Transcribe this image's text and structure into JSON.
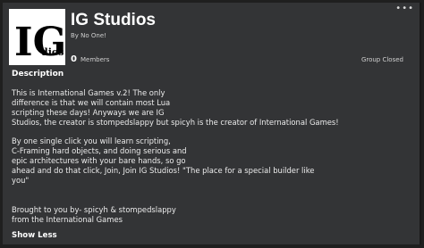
{
  "header": {
    "menu_glyph": "•••",
    "logo_text_main": "IG",
    "logo_text_small": "dios",
    "title": "IG Studios",
    "byline": "By No One!"
  },
  "stats": {
    "member_count": "0",
    "member_label": "Members",
    "group_status": "Group Closed"
  },
  "description": {
    "heading": "Description",
    "lines": [
      "This is International Games v.2! The only",
      "difference is that we will contain most Lua",
      "scripting these days! Anyways we are IG",
      "Studios, the creator is stompedslappy but spicyh is the creator of International Games!",
      "",
      "By one single click you will learn scripting,",
      "C-Framing hard objects, and doing serious and",
      "epic architectures with your bare hands, so go",
      "ahead and do that click, Join, Join IG Studios! \"The place for a special builder like",
      "you\"",
      "",
      "",
      "Brought to you by- spicyh & stompedslappy",
      "from the International Games"
    ],
    "toggle_label": "Show Less"
  }
}
